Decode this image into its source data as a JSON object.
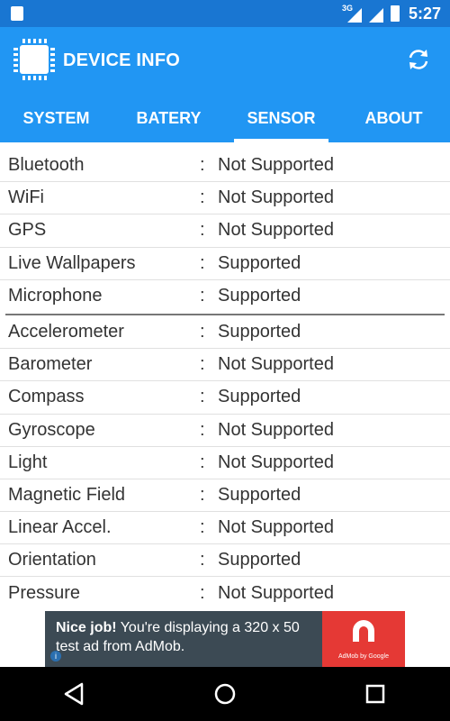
{
  "status_bar": {
    "network_type": "3G",
    "time": "5:27"
  },
  "app_bar": {
    "title": "DEVICE INFO",
    "logo_icon": "chip-icon",
    "refresh_icon": "refresh-icon"
  },
  "tabs": [
    {
      "label": "SYSTEM",
      "active": false
    },
    {
      "label": "BATERY",
      "active": false
    },
    {
      "label": "SENSOR",
      "active": true
    },
    {
      "label": "ABOUT",
      "active": false
    }
  ],
  "features": [
    {
      "label": "Bluetooth",
      "sep": ":",
      "value": "Not Supported"
    },
    {
      "label": "WiFi",
      "sep": ":",
      "value": "Not Supported"
    },
    {
      "label": "GPS",
      "sep": ":",
      "value": "Not Supported"
    },
    {
      "label": "Live Wallpapers",
      "sep": ":",
      "value": "Supported"
    },
    {
      "label": "Microphone",
      "sep": ":",
      "value": "Supported"
    }
  ],
  "sensors": [
    {
      "label": "Accelerometer",
      "sep": ":",
      "value": "Supported"
    },
    {
      "label": "Barometer",
      "sep": ":",
      "value": "Not Supported"
    },
    {
      "label": "Compass",
      "sep": ":",
      "value": "Supported"
    },
    {
      "label": "Gyroscope",
      "sep": ":",
      "value": "Not Supported"
    },
    {
      "label": "Light",
      "sep": ":",
      "value": "Not Supported"
    },
    {
      "label": "Magnetic Field",
      "sep": ":",
      "value": "Supported"
    },
    {
      "label": "Linear Accel.",
      "sep": ":",
      "value": "Not Supported"
    },
    {
      "label": "Orientation",
      "sep": ":",
      "value": "Supported"
    },
    {
      "label": "Pressure",
      "sep": ":",
      "value": "Not Supported"
    }
  ],
  "ad": {
    "headline": "Nice job!",
    "body": " You're displaying a 320 x 50 test ad from AdMob.",
    "brand": "AdMob by Google",
    "info_glyph": "i"
  },
  "colors": {
    "status_bar": "#1976d2",
    "app_bar": "#2196f3",
    "ad_bg": "#3c4a54",
    "ad_brand": "#e53935"
  }
}
